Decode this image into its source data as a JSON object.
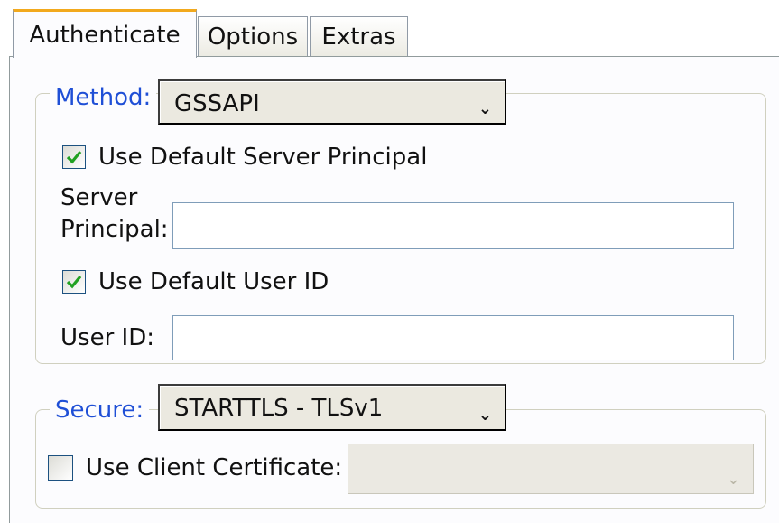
{
  "tabs": [
    {
      "label": "Authenticate",
      "active": true
    },
    {
      "label": "Options",
      "active": false
    },
    {
      "label": "Extras",
      "active": false
    }
  ],
  "method_group": {
    "legend": "Method:",
    "dropdown_value": "GSSAPI",
    "use_default_server_principal": {
      "label": "Use Default Server Principal",
      "checked": true
    },
    "server_principal": {
      "label_line1": "Server",
      "label_line2": "Principal:",
      "value": ""
    },
    "use_default_user_id": {
      "label": "Use Default User ID",
      "checked": true
    },
    "user_id": {
      "label": "User ID:",
      "value": ""
    }
  },
  "secure_group": {
    "legend": "Secure:",
    "dropdown_value": "STARTTLS - TLSv1",
    "use_client_certificate": {
      "label": "Use Client Certificate:",
      "checked": false
    },
    "certificate_value": ""
  },
  "colors": {
    "accent_tab": "#f2a91d",
    "legend_text": "#1f4fd6",
    "check_green": "#21a121"
  },
  "icons": {
    "dropdown_arrow": "chevron-down-icon",
    "check": "checkmark-icon"
  }
}
